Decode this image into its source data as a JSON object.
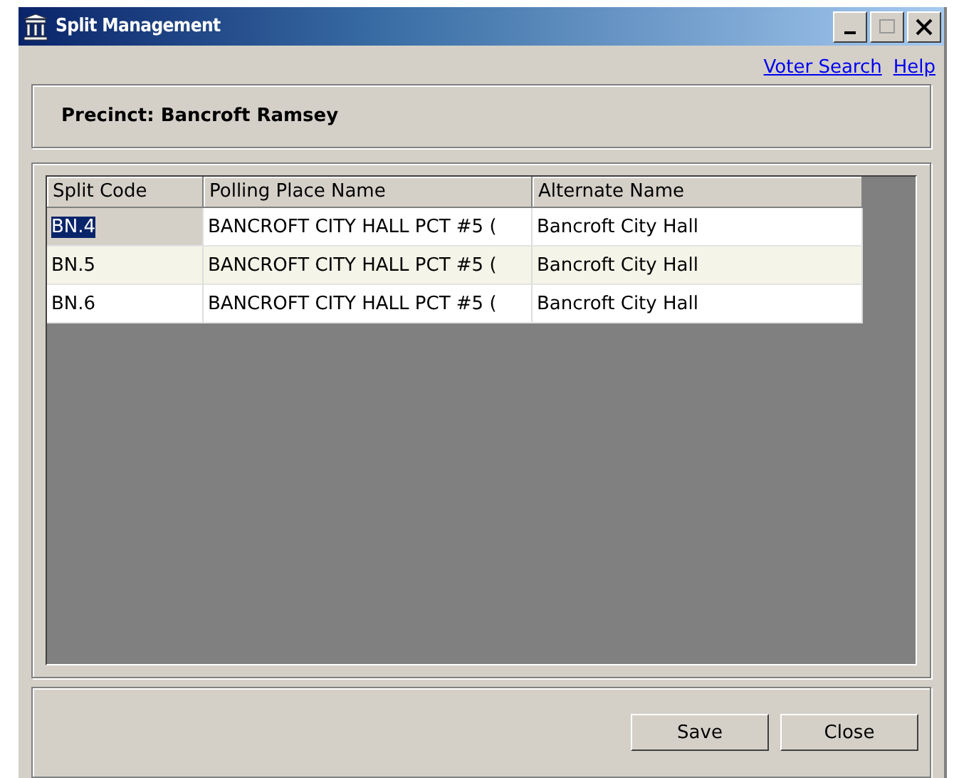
{
  "window": {
    "title": "Split Management"
  },
  "links": [
    "Voter Search",
    "Help"
  ],
  "precinct": {
    "label": "Precinct:",
    "value": "Bancroft Ramsey"
  },
  "table": {
    "columns": [
      "Split Code",
      "Polling Place Name",
      "Alternate Name"
    ],
    "rows": [
      {
        "cells": [
          "BN.4",
          "BANCROFT CITY HALL PCT #5 (",
          "Bancroft City Hall"
        ],
        "selected": true
      },
      {
        "cells": [
          "BN.5",
          "BANCROFT CITY HALL PCT #5 (",
          "Bancroft City Hall"
        ],
        "selected": false
      },
      {
        "cells": [
          "BN.6",
          "BANCROFT CITY HALL PCT #5 (",
          "Bancroft City Hall"
        ],
        "selected": false
      }
    ]
  },
  "buttons": [
    "Save",
    "Close"
  ]
}
